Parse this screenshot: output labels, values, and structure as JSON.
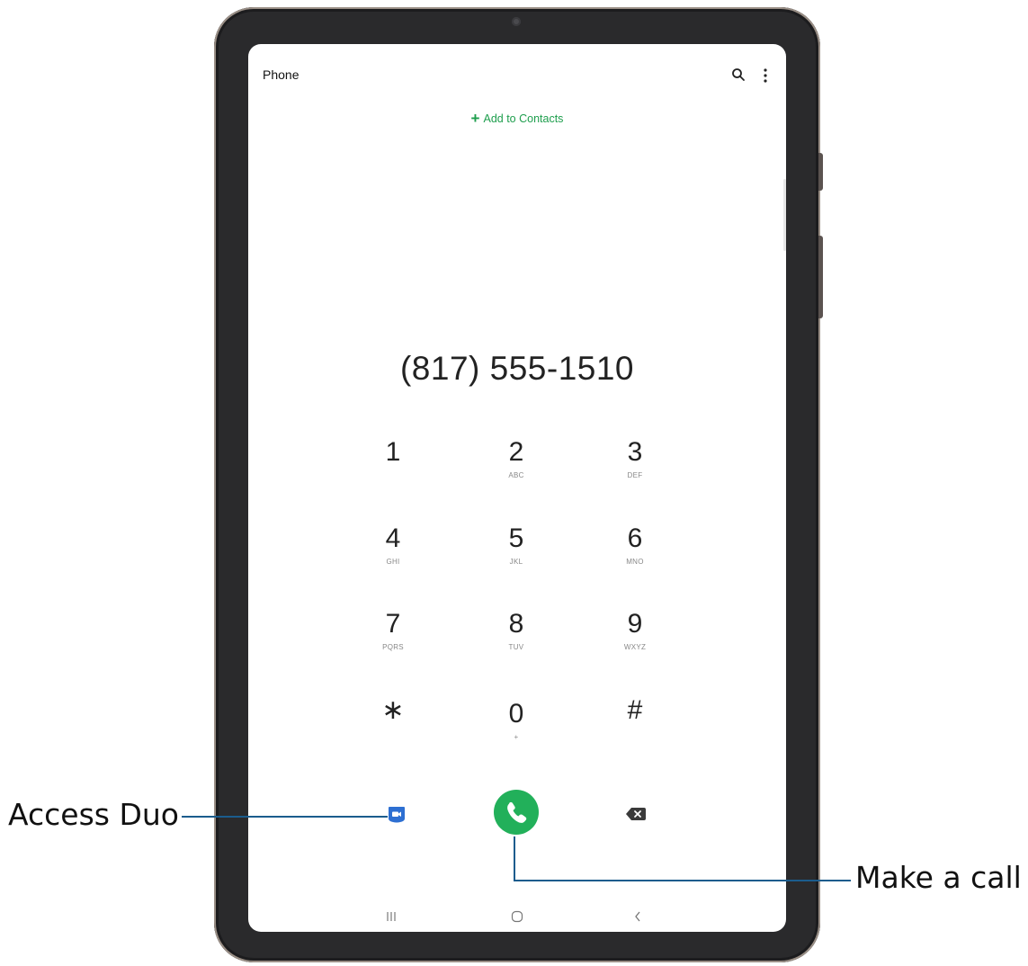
{
  "app": {
    "title": "Phone"
  },
  "header": {
    "add_contacts": "Add to Contacts",
    "add_icon": "+"
  },
  "dialer": {
    "number": "(817) 555-1510",
    "keys": [
      {
        "digit": "1",
        "letters": ""
      },
      {
        "digit": "2",
        "letters": "ABC"
      },
      {
        "digit": "3",
        "letters": "DEF"
      },
      {
        "digit": "4",
        "letters": "GHI"
      },
      {
        "digit": "5",
        "letters": "JKL"
      },
      {
        "digit": "6",
        "letters": "MNO"
      },
      {
        "digit": "7",
        "letters": "PQRS"
      },
      {
        "digit": "8",
        "letters": "TUV"
      },
      {
        "digit": "9",
        "letters": "WXYZ"
      },
      {
        "digit": "∗",
        "letters": ""
      },
      {
        "digit": "0",
        "letters": "+"
      },
      {
        "digit": "#",
        "letters": ""
      }
    ]
  },
  "icons": {
    "search": "search-icon",
    "more": "more-vert-icon",
    "duo": "video-camera-icon",
    "call": "phone-icon",
    "backspace": "backspace-icon",
    "recent": "recent-apps-icon",
    "home": "home-icon",
    "back": "back-icon"
  },
  "callouts": {
    "duo": "Access Duo",
    "call": "Make a call"
  },
  "colors": {
    "accent_green": "#22b05a",
    "link_green": "#1e9e4d",
    "duo_blue": "#2d6fd2",
    "callout_line": "#1b5c8d"
  }
}
